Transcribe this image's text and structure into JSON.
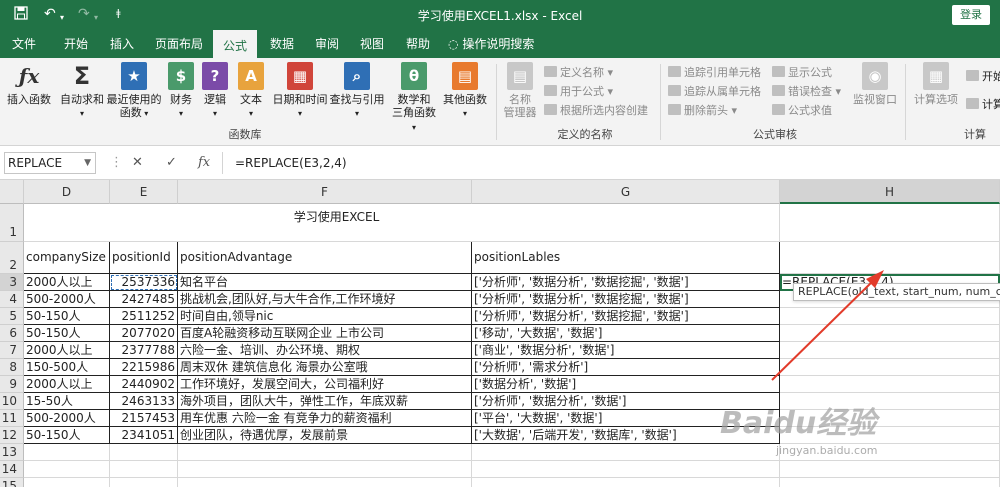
{
  "titlebar": {
    "title": "学习使用EXCEL1.xlsx  -  Excel",
    "login": "登录",
    "customize": "ǂ"
  },
  "tabs": [
    "文件",
    "开始",
    "插入",
    "页面布局",
    "公式",
    "数据",
    "审阅",
    "视图",
    "帮助"
  ],
  "tell_me": "操作说明搜索",
  "ribbon": {
    "big_buttons": [
      {
        "label1": "插入函数",
        "label2": "",
        "icon": "fx-icon",
        "color": "#ffffff",
        "glyph": "fx"
      },
      {
        "label1": "自动求和",
        "label2": "",
        "icon": "sigma-icon",
        "color": "#ffffff",
        "glyph": "Σ"
      },
      {
        "label1": "最近使用的",
        "label2": "函数",
        "icon": "star-book-icon",
        "color": "#2f6fb5",
        "glyph": "★"
      },
      {
        "label1": "财务",
        "label2": "",
        "icon": "finance-book-icon",
        "color": "#4a9a6b",
        "glyph": "$"
      },
      {
        "label1": "逻辑",
        "label2": "",
        "icon": "logic-book-icon",
        "color": "#7b4ba8",
        "glyph": "?"
      },
      {
        "label1": "文本",
        "label2": "",
        "icon": "text-book-icon",
        "color": "#e8a33d",
        "glyph": "A"
      },
      {
        "label1": "日期和时间",
        "label2": "",
        "icon": "calendar-icon",
        "color": "#d0453a",
        "glyph": "▦"
      },
      {
        "label1": "查找与引用",
        "label2": "",
        "icon": "lookup-icon",
        "color": "#2f6fb5",
        "glyph": "⌕"
      },
      {
        "label1": "数学和",
        "label2": "三角函数",
        "icon": "theta-book-icon",
        "color": "#4a9a6b",
        "glyph": "θ"
      },
      {
        "label1": "其他函数",
        "label2": "",
        "icon": "more-functions-icon",
        "color": "#e87a2e",
        "glyph": "▤"
      }
    ],
    "group_library": "函数库",
    "name_manager": {
      "label1": "名称",
      "label2": "管理器"
    },
    "defined_names": [
      "定义名称 ▾",
      "用于公式 ▾",
      "根据所选内容创建"
    ],
    "group_defined": "定义的名称",
    "audit": [
      "追踪引用单元格",
      "追踪从属单元格",
      "删除箭头 ▾",
      "显示公式",
      "错误检查 ▾",
      "公式求值"
    ],
    "watch_window": "监视窗口",
    "group_audit": "公式审核",
    "calc_options": "计算选项",
    "calc_right": [
      "开始",
      "计算"
    ],
    "group_calc": "计算"
  },
  "formula_bar": {
    "namebox": "REPLACE",
    "cancel": "✕",
    "enter": "✓",
    "fx": "fx",
    "formula": "=REPLACE(E3,2,4)"
  },
  "columns": [
    "D",
    "E",
    "F",
    "G",
    "H"
  ],
  "rows": [
    "1",
    "2",
    "3",
    "4",
    "5",
    "6",
    "7",
    "8",
    "9",
    "10",
    "11",
    "12",
    "13",
    "14",
    "15"
  ],
  "sheet_title": "学习使用EXCEL",
  "headers": [
    "companySize",
    "positionId",
    "positionAdvantage",
    "positionLables"
  ],
  "data": [
    [
      "2000人以上",
      "2537336",
      "知名平台",
      "['分析师', '数据分析', '数据挖掘', '数据']"
    ],
    [
      "500-2000人",
      "2427485",
      "挑战机会,团队好,与大牛合作,工作环境好",
      "['分析师', '数据分析', '数据挖掘', '数据']"
    ],
    [
      "50-150人",
      "2511252",
      "时间自由,领导nic",
      "['分析师', '数据分析', '数据挖掘', '数据']"
    ],
    [
      "50-150人",
      "2077020",
      "百度A轮融资移动互联网企业 上市公司",
      "['移动', '大数据', '数据']"
    ],
    [
      "2000人以上",
      "2377788",
      "六险一金、培训、办公环境、期权",
      "['商业', '数据分析', '数据']"
    ],
    [
      "150-500人",
      "2215986",
      "周末双休 建筑信息化 海景办公室哦",
      "['分析师', '需求分析']"
    ],
    [
      "2000人以上",
      "2440902",
      "工作环境好，发展空间大，公司福利好",
      "['数据分析', '数据']"
    ],
    [
      "15-50人",
      "2463133",
      "海外项目，团队大牛，弹性工作，年底双薪",
      "['分析师', '数据分析', '数据']"
    ],
    [
      "500-2000人",
      "2157453",
      "用车优惠 六险一金 有竞争力的薪资福利",
      "['平台', '大数据', '数据']"
    ],
    [
      "50-150人",
      "2341051",
      "创业团队，待遇优厚，发展前景",
      "['大数据', '后端开发', '数据库', '数据']"
    ]
  ],
  "edit_cell": "=REPLACE(E3,2,4)",
  "tooltip": "REPLACE(old_text, start_num, num_chars, new_text)",
  "watermark": "Baidu经验",
  "watermark_sub": "jingyan.baidu.com"
}
